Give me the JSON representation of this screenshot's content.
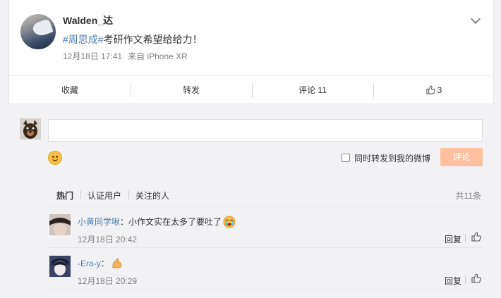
{
  "post": {
    "username": "Walden_达",
    "hashtag": "#周思成#",
    "text": "考研作文希望给给力！",
    "date": "12月18日 17:41",
    "source": "来自 iPhone XR",
    "icon": "chevron-down-icon"
  },
  "actions": {
    "favorite": "收藏",
    "repost": "转发",
    "comment": "评论 11",
    "like_count": "3",
    "like_icon": "thumb-up-icon"
  },
  "composer": {
    "placeholder": "",
    "repost_option": "同时转发到我的微博",
    "repost_checked": false,
    "submit": "评论",
    "submit_color": "#ffc09f"
  },
  "filters": {
    "items": [
      "热门",
      "认证用户",
      "关注的人"
    ],
    "total": "共11条"
  },
  "comments": [
    {
      "name": "小黄同学啾",
      "separator": "：",
      "text": "小作文实在太多了要吐了",
      "emoji": "crying-face-emoji",
      "time": "12月18日 20:42",
      "reply": "回复"
    },
    {
      "name": "-Era-y",
      "separator": "：",
      "text": "",
      "emoji": "flexed-biceps-emoji",
      "time": "12月18日 20:29",
      "reply": "回复"
    }
  ],
  "colors": {
    "link": "#507daf",
    "meta": "#808080",
    "background": "#f2f2f5"
  }
}
